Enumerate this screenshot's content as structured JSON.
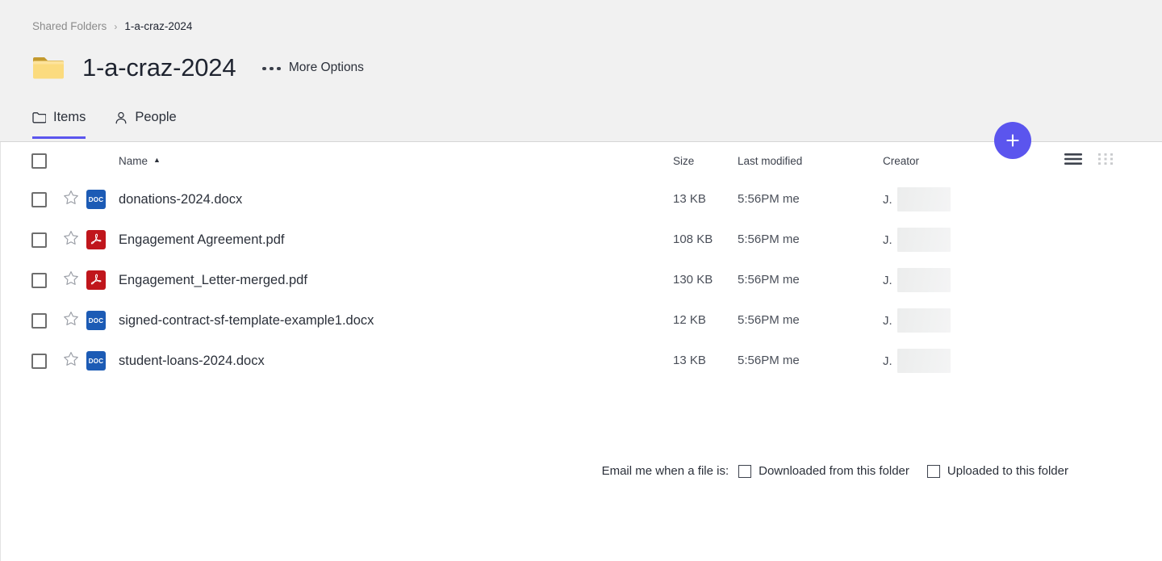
{
  "breadcrumb": {
    "parent": "Shared Folders",
    "separator": "›",
    "current": "1-a-craz-2024"
  },
  "header": {
    "folder_icon": "folder-icon",
    "title": "1-a-craz-2024",
    "more_options_label": "More Options",
    "more_options_icon": "ellipsis-icon"
  },
  "tabs": [
    {
      "label": "Items",
      "icon": "folder-outline-icon",
      "active": true
    },
    {
      "label": "People",
      "icon": "person-icon",
      "active": false
    }
  ],
  "fab": {
    "label": "+",
    "icon": "plus-icon",
    "color": "#5b55ee"
  },
  "table": {
    "select_all_icon": "checkbox-icon",
    "columns": {
      "name": "Name",
      "sort_arrow": "▲",
      "size": "Size",
      "last_modified": "Last modified",
      "creator": "Creator"
    },
    "view_toggles": [
      {
        "name": "list-view-icon",
        "active": true
      },
      {
        "name": "grid-view-icon",
        "active": false
      }
    ],
    "rows": [
      {
        "name": "donations-2024.docx",
        "type": "doc",
        "type_label": "DOC",
        "size": "13 KB",
        "last_modified": "5:56PM me",
        "creator_initial": "J.",
        "creator_redacted": true
      },
      {
        "name": "Engagement Agreement.pdf",
        "type": "pdf",
        "type_label": "PDF",
        "size": "108 KB",
        "last_modified": "5:56PM me",
        "creator_initial": "J.",
        "creator_redacted": true
      },
      {
        "name": "Engagement_Letter-merged.pdf",
        "type": "pdf",
        "type_label": "PDF",
        "size": "130 KB",
        "last_modified": "5:56PM me",
        "creator_initial": "J.",
        "creator_redacted": true
      },
      {
        "name": "signed-contract-sf-template-example1.docx",
        "type": "doc",
        "type_label": "DOC",
        "size": "12 KB",
        "last_modified": "5:56PM me",
        "creator_initial": "J.",
        "creator_redacted": true
      },
      {
        "name": "student-loans-2024.docx",
        "type": "doc",
        "type_label": "DOC",
        "size": "13 KB",
        "last_modified": "5:56PM me",
        "creator_initial": "J.",
        "creator_redacted": true
      }
    ]
  },
  "notify": {
    "label": "Email me when a file is:",
    "options": [
      {
        "label": "Downloaded from this folder",
        "checked": false
      },
      {
        "label": "Uploaded to this folder",
        "checked": false
      }
    ]
  },
  "colors": {
    "accent": "#5b55ee",
    "header_bg": "#f1f1f1",
    "doc_icon": "#1c5bb5",
    "pdf_icon": "#c0161c",
    "folder": "#fcdc7d"
  }
}
